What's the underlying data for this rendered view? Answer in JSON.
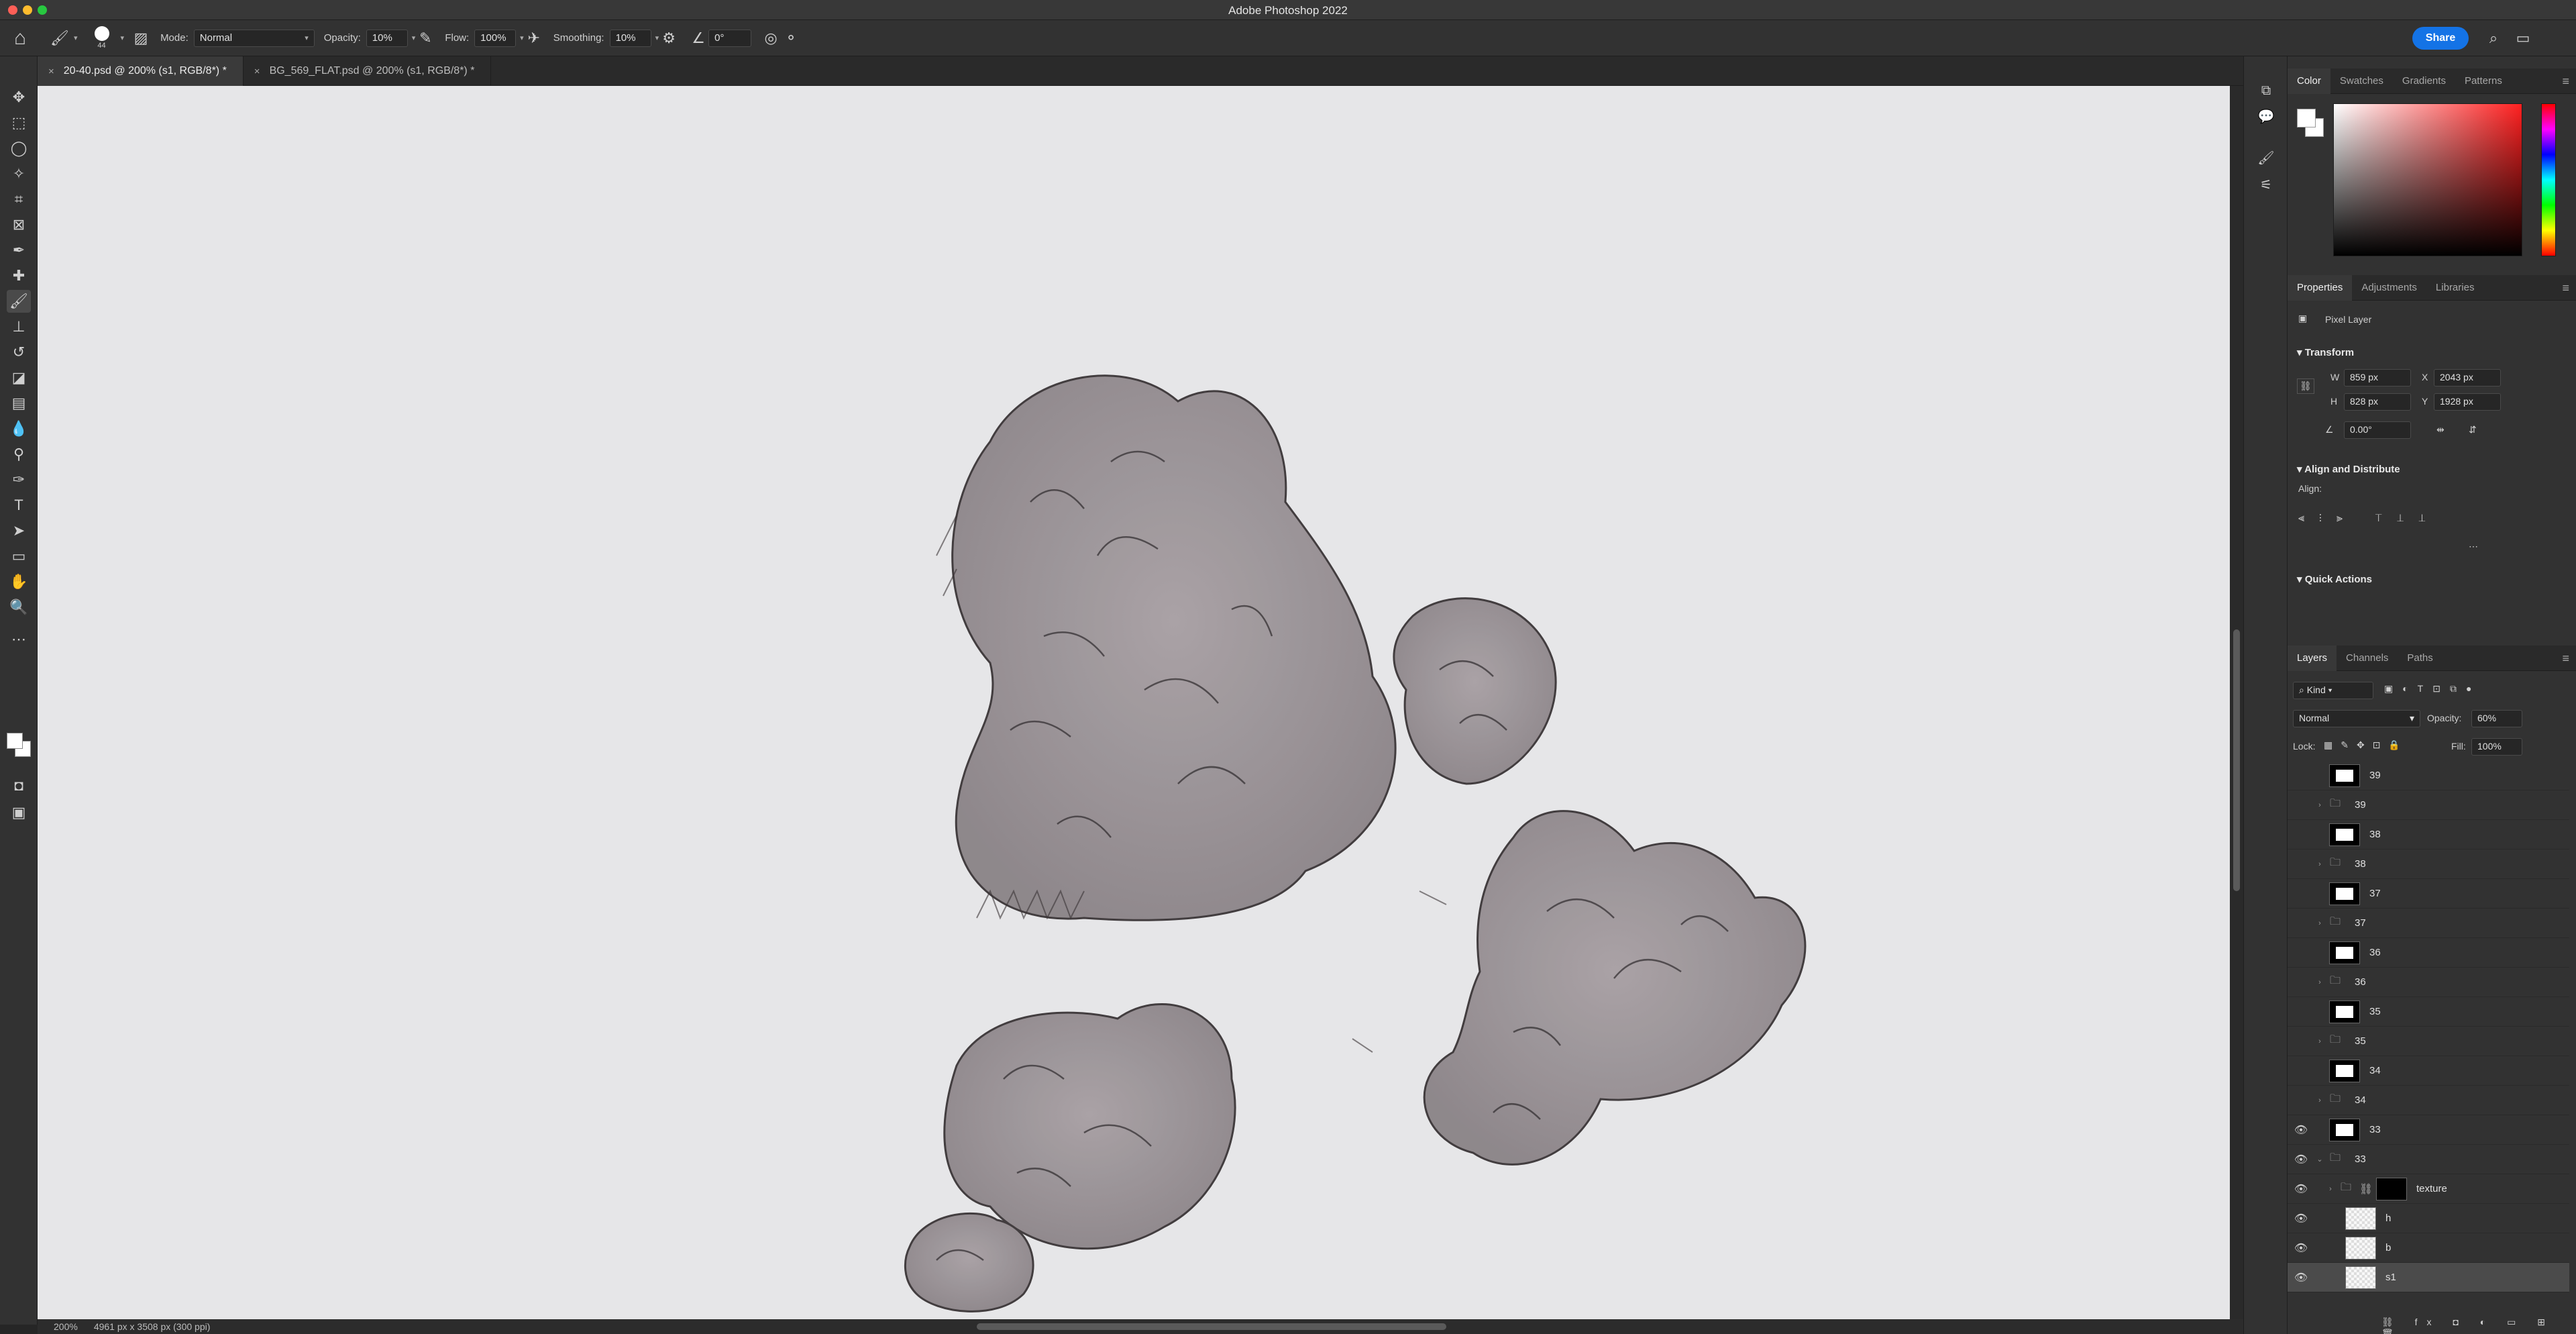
{
  "app": {
    "title": "Adobe Photoshop 2022"
  },
  "options": {
    "brush_size": "44",
    "mode_label": "Mode:",
    "mode_value": "Normal",
    "opacity_label": "Opacity:",
    "opacity_value": "10%",
    "flow_label": "Flow:",
    "flow_value": "100%",
    "smoothing_label": "Smoothing:",
    "smoothing_value": "10%",
    "angle_value": "0°",
    "share_label": "Share"
  },
  "tabs": [
    {
      "label": "20-40.psd @ 200% (s1, RGB/8*) *"
    },
    {
      "label": "BG_569_FLAT.psd @ 200% (s1, RGB/8*) *"
    }
  ],
  "status": {
    "zoom": "200%",
    "doc_info": "4961 px x 3508 px (300 ppi)"
  },
  "color_panel": {
    "tabs": [
      "Color",
      "Swatches",
      "Gradients",
      "Patterns"
    ]
  },
  "properties_panel": {
    "tabs": [
      "Properties",
      "Adjustments",
      "Libraries"
    ],
    "layer_type": "Pixel Layer",
    "transform_title": "Transform",
    "w_label": "W",
    "w_value": "859 px",
    "h_label": "H",
    "h_value": "828 px",
    "x_label": "X",
    "x_value": "2043 px",
    "y_label": "Y",
    "y_value": "1928 px",
    "angle_value": "0.00°",
    "align_title": "Align and Distribute",
    "align_label": "Align:",
    "quick_title": "Quick Actions"
  },
  "layers_panel": {
    "tabs": [
      "Layers",
      "Channels",
      "Paths"
    ],
    "filter_value": "Kind",
    "blend_value": "Normal",
    "opacity_label": "Opacity:",
    "opacity_value": "60%",
    "lock_label": "Lock:",
    "fill_label": "Fill:",
    "fill_value": "100%",
    "layers": [
      {
        "name": "39",
        "kind": "mask",
        "visible": false
      },
      {
        "name": "39",
        "kind": "group",
        "visible": false
      },
      {
        "name": "38",
        "kind": "mask",
        "visible": false
      },
      {
        "name": "38",
        "kind": "group",
        "visible": false
      },
      {
        "name": "37",
        "kind": "mask",
        "visible": false
      },
      {
        "name": "37",
        "kind": "group",
        "visible": false
      },
      {
        "name": "36",
        "kind": "mask",
        "visible": false
      },
      {
        "name": "36",
        "kind": "group",
        "visible": false
      },
      {
        "name": "35",
        "kind": "mask",
        "visible": false
      },
      {
        "name": "35",
        "kind": "group",
        "visible": false
      },
      {
        "name": "34",
        "kind": "mask",
        "visible": false
      },
      {
        "name": "34",
        "kind": "group",
        "visible": false
      },
      {
        "name": "33",
        "kind": "mask",
        "visible": true
      },
      {
        "name": "33",
        "kind": "group-open",
        "visible": true
      },
      {
        "name": "texture",
        "kind": "subgroup",
        "visible": true
      },
      {
        "name": "h",
        "kind": "pixel",
        "visible": true
      },
      {
        "name": "b",
        "kind": "pixel",
        "visible": true
      },
      {
        "name": "s1",
        "kind": "pixel",
        "visible": true,
        "selected": true
      }
    ]
  }
}
